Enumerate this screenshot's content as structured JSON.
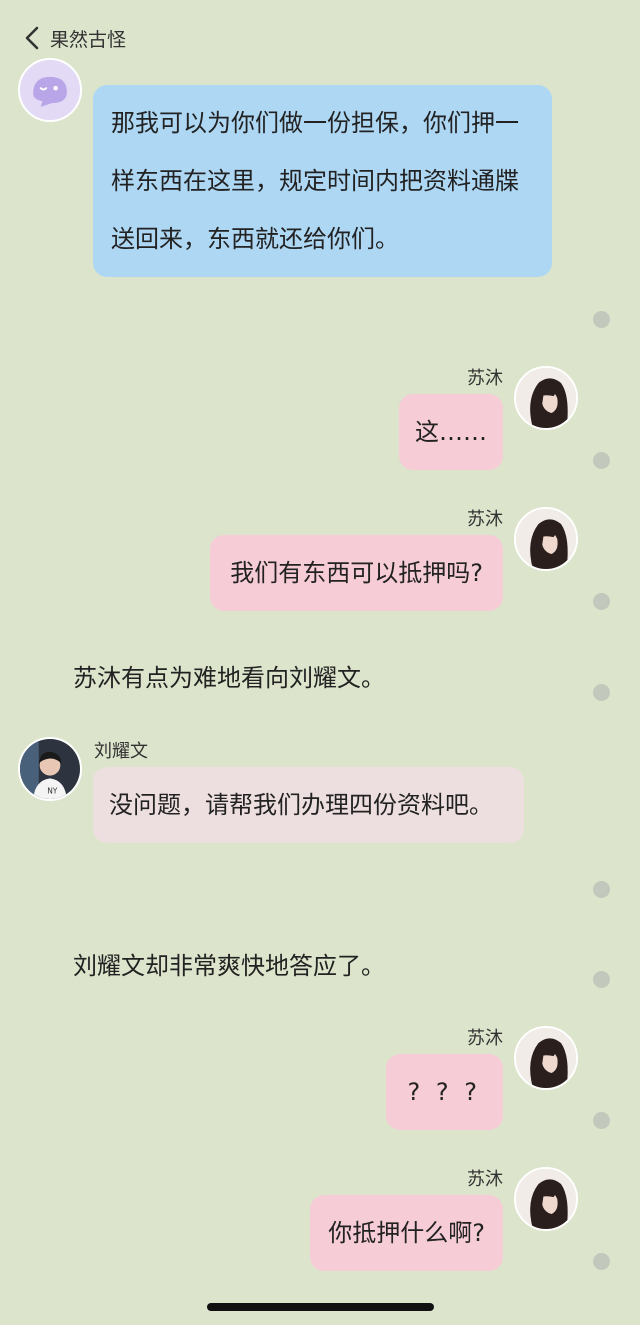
{
  "header": {
    "back_icon": "chevron-left-icon",
    "title": "果然古怪"
  },
  "colors": {
    "background": "#dce5cc",
    "bubble_blue": "#aed7f4",
    "bubble_pink": "#f6ccd6",
    "bubble_light_pink": "#eddfdf",
    "dot": "#c3c8bd"
  },
  "messages": [
    {
      "kind": "chat",
      "speaker": "",
      "avatar": "ghost-mascot-avatar",
      "text": "那我可以为你们做一份担保，你们押一样东西在这里，规定时间内把资料通牒送回来，东西就还给你们。"
    },
    {
      "kind": "chat",
      "speaker": "苏沐",
      "avatar": "long-haired-girl-avatar",
      "text": "这……"
    },
    {
      "kind": "chat",
      "speaker": "苏沐",
      "avatar": "long-haired-girl-avatar",
      "text": "我们有东西可以抵押吗?"
    },
    {
      "kind": "narration",
      "text": "苏沐有点为难地看向刘耀文。"
    },
    {
      "kind": "chat",
      "speaker": "刘耀文",
      "avatar": "young-man-avatar",
      "text": "没问题，请帮我们办理四份资料吧。"
    },
    {
      "kind": "narration",
      "text": "刘耀文却非常爽快地答应了。"
    },
    {
      "kind": "chat",
      "speaker": "苏沐",
      "avatar": "long-haired-girl-avatar",
      "text": "? ? ?"
    },
    {
      "kind": "chat",
      "speaker": "苏沐",
      "avatar": "long-haired-girl-avatar",
      "text": "你抵押什么啊?"
    }
  ]
}
